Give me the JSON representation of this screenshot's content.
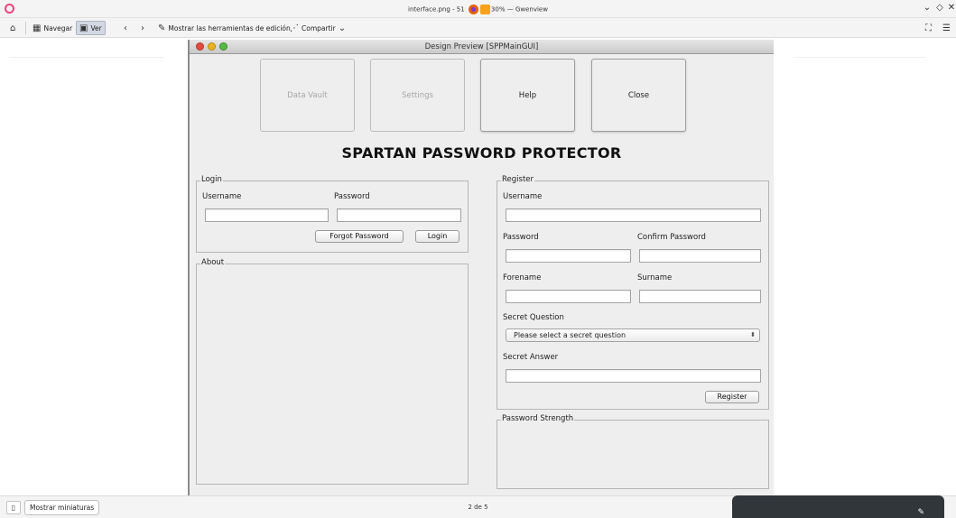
{
  "window": {
    "title_prefix": "interface.png - 51",
    "title_zoom": "30%",
    "title_suffix": "— Gwenview",
    "controls": {
      "minimize": "⌄",
      "maximize": "◇",
      "close": "✕"
    }
  },
  "toolbar": {
    "home_icon": "home-icon",
    "browse_label": "Navegar",
    "view_label": "Ver",
    "back_icon": "chevron-left-icon",
    "forward_icon": "chevron-right-icon",
    "edit_tools_label": "Mostrar las herramientas de edición",
    "share_label": "Compartir",
    "fullscreen_icon": "fullscreen-icon",
    "menu_icon": "hamburger-menu-icon"
  },
  "preview": {
    "title": "Design Preview [SPPMainGUI]",
    "nav_buttons": [
      {
        "label": "Data Vault",
        "enabled": false
      },
      {
        "label": "Settings",
        "enabled": false
      },
      {
        "label": "Help",
        "enabled": true
      },
      {
        "label": "Close",
        "enabled": true
      }
    ],
    "header": "SPARTAN PASSWORD PROTECTOR",
    "login": {
      "legend": "Login",
      "username_label": "Username",
      "password_label": "Password",
      "username_value": "",
      "password_value": "",
      "forgot_button": "Forgot Password",
      "login_button": "Login"
    },
    "about": {
      "legend": "About"
    },
    "register": {
      "legend": "Register",
      "username_label": "Username",
      "password_label": "Password",
      "confirm_label": "Confirm Password",
      "forename_label": "Forename",
      "surname_label": "Surname",
      "secret_question_label": "Secret Question",
      "secret_question_selected": "Please select a secret question",
      "secret_answer_label": "Secret Answer",
      "register_button": "Register"
    },
    "strength": {
      "legend": "Password Strength"
    }
  },
  "statusbar": {
    "thumbnails_label": "Mostrar miniaturas",
    "page_indicator": "2 de 5"
  },
  "colors": {
    "chrome_bg": "#f4f4f4",
    "preview_bg": "#eeeeee",
    "notification_bg": "#31363b"
  }
}
